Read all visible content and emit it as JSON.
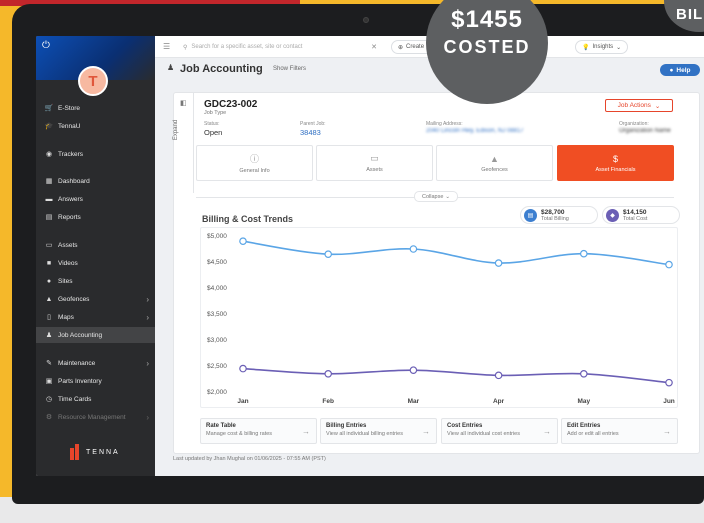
{
  "badge": {
    "amount": "$1455",
    "label": "COSTED"
  },
  "badge2": {
    "label": "BIL"
  },
  "sidebar": {
    "avatar_letter": "T",
    "items": [
      {
        "label": "E-Store",
        "icon": "cart-icon"
      },
      {
        "label": "TennaU",
        "icon": "graduation-icon"
      },
      {
        "label": "Trackers",
        "icon": "tracker-icon"
      },
      {
        "label": "Dashboard",
        "icon": "dashboard-icon"
      },
      {
        "label": "Answers",
        "icon": "chat-icon"
      },
      {
        "label": "Reports",
        "icon": "report-icon"
      },
      {
        "label": "Assets",
        "icon": "asset-icon"
      },
      {
        "label": "Videos",
        "icon": "video-icon"
      },
      {
        "label": "Sites",
        "icon": "pin-icon"
      },
      {
        "label": "Geofences",
        "icon": "geofence-icon"
      },
      {
        "label": "Maps",
        "icon": "map-icon"
      },
      {
        "label": "Job Accounting",
        "icon": "job-icon"
      },
      {
        "label": "Maintenance",
        "icon": "wrench-icon"
      },
      {
        "label": "Parts Inventory",
        "icon": "box-icon"
      },
      {
        "label": "Time Cards",
        "icon": "clock-icon"
      },
      {
        "label": "Resource Management",
        "icon": "resource-icon"
      }
    ],
    "logo_text": "TENNA"
  },
  "topbar": {
    "search_placeholder": "Search for a specific asset, site or contact",
    "create_label": "Create",
    "insights_label": "Insights"
  },
  "header": {
    "title": "Job Accounting",
    "show_filters": "Show Filters",
    "help": "Help"
  },
  "job": {
    "expand_label": "Expand",
    "id": "GDC23-002",
    "type": "Job Type",
    "actions": "Job Actions",
    "status_label": "Status:",
    "status_value": "Open",
    "parent_label": "Parent Job:",
    "parent_value": "38483",
    "address_label": "Mailing Address:",
    "address_value": "2040 Lincoln Hwy, Edison, NJ 08817",
    "org_label": "Organization:",
    "org_value": "Organization Name"
  },
  "tiles": [
    {
      "label": "General Info",
      "icon": "info-icon"
    },
    {
      "label": "Assets",
      "icon": "asset-icon"
    },
    {
      "label": "Geofences",
      "icon": "geofence-icon"
    },
    {
      "label": "Asset Financials",
      "icon": "dollar-icon"
    }
  ],
  "collapse_label": "Collapse",
  "kpis": {
    "billing_value": "$28,700",
    "billing_label": "Total Billing",
    "cost_value": "$14,150",
    "cost_label": "Total Cost"
  },
  "colors": {
    "accent": "#f04e23",
    "billing_line": "#5aa5e6",
    "cost_line": "#6b5fb5",
    "help": "#3172c4"
  },
  "chart_data": {
    "type": "line",
    "title": "Billing & Cost Trends",
    "categories": [
      "Jan",
      "Feb",
      "Mar",
      "Apr",
      "May",
      "Jun"
    ],
    "yticks": [
      "$5,000",
      "$4,500",
      "$4,000",
      "$3,500",
      "$3,000",
      "$2,500",
      "$2,000"
    ],
    "ylim": [
      2000,
      5000
    ],
    "grid": false,
    "series": [
      {
        "values": [
          4900,
          4650,
          4750,
          4480,
          4660,
          4450
        ]
      },
      {
        "values": [
          2450,
          2350,
          2420,
          2320,
          2350,
          2180
        ]
      }
    ]
  },
  "bottom_links": [
    {
      "title": "Rate Table",
      "subtitle": "Manage cost & billing rates"
    },
    {
      "title": "Billing Entries",
      "subtitle": "View all individual billing entries"
    },
    {
      "title": "Cost Entries",
      "subtitle": "View all individual cost entries"
    },
    {
      "title": "Edit Entries",
      "subtitle": "Add or edit all entries"
    }
  ],
  "last_updated": "Last updated by Jhan Mughal on 01/06/2025 - 07:55 AM (PST)"
}
